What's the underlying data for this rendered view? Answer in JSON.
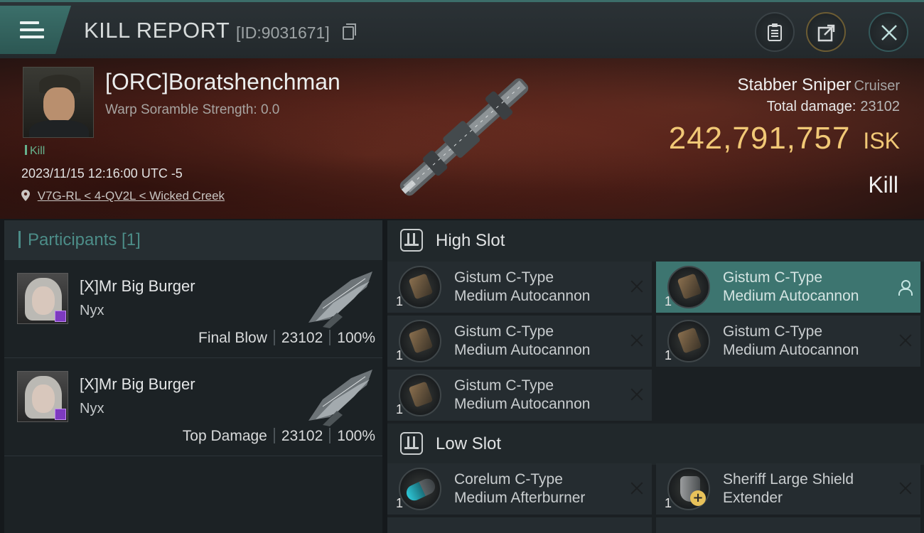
{
  "header": {
    "title": "KILL REPORT",
    "report_id": "[ID:9031671]"
  },
  "victim": {
    "name": "[ORC]Boratshenchman",
    "warp_scramble": "Warp Soramble Strength: 0.0",
    "kill_tag": "Kill",
    "datetime": "2023/11/15 12:16:00 UTC -5",
    "location": "V7G-RL < 4-QV2L < Wicked Creek",
    "ship_name": "Stabber Sniper",
    "ship_class": "Cruiser",
    "total_damage_label": "Total damage:",
    "total_damage": "23102",
    "isk_value": "242,791,757",
    "isk_unit": "ISK",
    "outcome": "Kill"
  },
  "participants": {
    "tab_label": "Participants [1]",
    "rows": [
      {
        "name": "[X]Mr Big Burger",
        "ship": "Nyx",
        "role": "Final Blow",
        "damage": "23102",
        "percent": "100%"
      },
      {
        "name": "[X]Mr Big Burger",
        "ship": "Nyx",
        "role": "Top Damage",
        "damage": "23102",
        "percent": "100%"
      }
    ]
  },
  "fitting": {
    "high_slot_label": "High Slot",
    "low_slot_label": "Low Slot",
    "high_slot": [
      {
        "line1": "Gistum C-Type",
        "line2": "Medium Autocannon",
        "qty": "1",
        "icon": "autocannon-icon"
      },
      {
        "line1": "Gistum C-Type",
        "line2": "Medium Autocannon",
        "qty": "1",
        "icon": "autocannon-icon"
      },
      {
        "line1": "Gistum C-Type",
        "line2": "Medium Autocannon",
        "qty": "1",
        "icon": "autocannon-icon"
      },
      {
        "line1": "Gistum C-Type",
        "line2": "Medium Autocannon",
        "qty": "1",
        "icon": "autocannon-icon"
      },
      {
        "line1": "Gistum C-Type",
        "line2": "Medium Autocannon",
        "qty": "1",
        "icon": "autocannon-icon"
      }
    ],
    "low_slot": [
      {
        "line1": "Corelum C-Type",
        "line2": "Medium Afterburner",
        "qty": "1",
        "icon": "afterburner-icon"
      },
      {
        "line1": "Sheriff Large Shield",
        "line2": "Extender",
        "qty": "1",
        "icon": "shield-extender-icon"
      }
    ]
  },
  "colors": {
    "accent_teal": "#3d7570",
    "isk_gold": "#f1c876",
    "kill_green": "#66b28d",
    "hero_red": "#6e2f22"
  }
}
